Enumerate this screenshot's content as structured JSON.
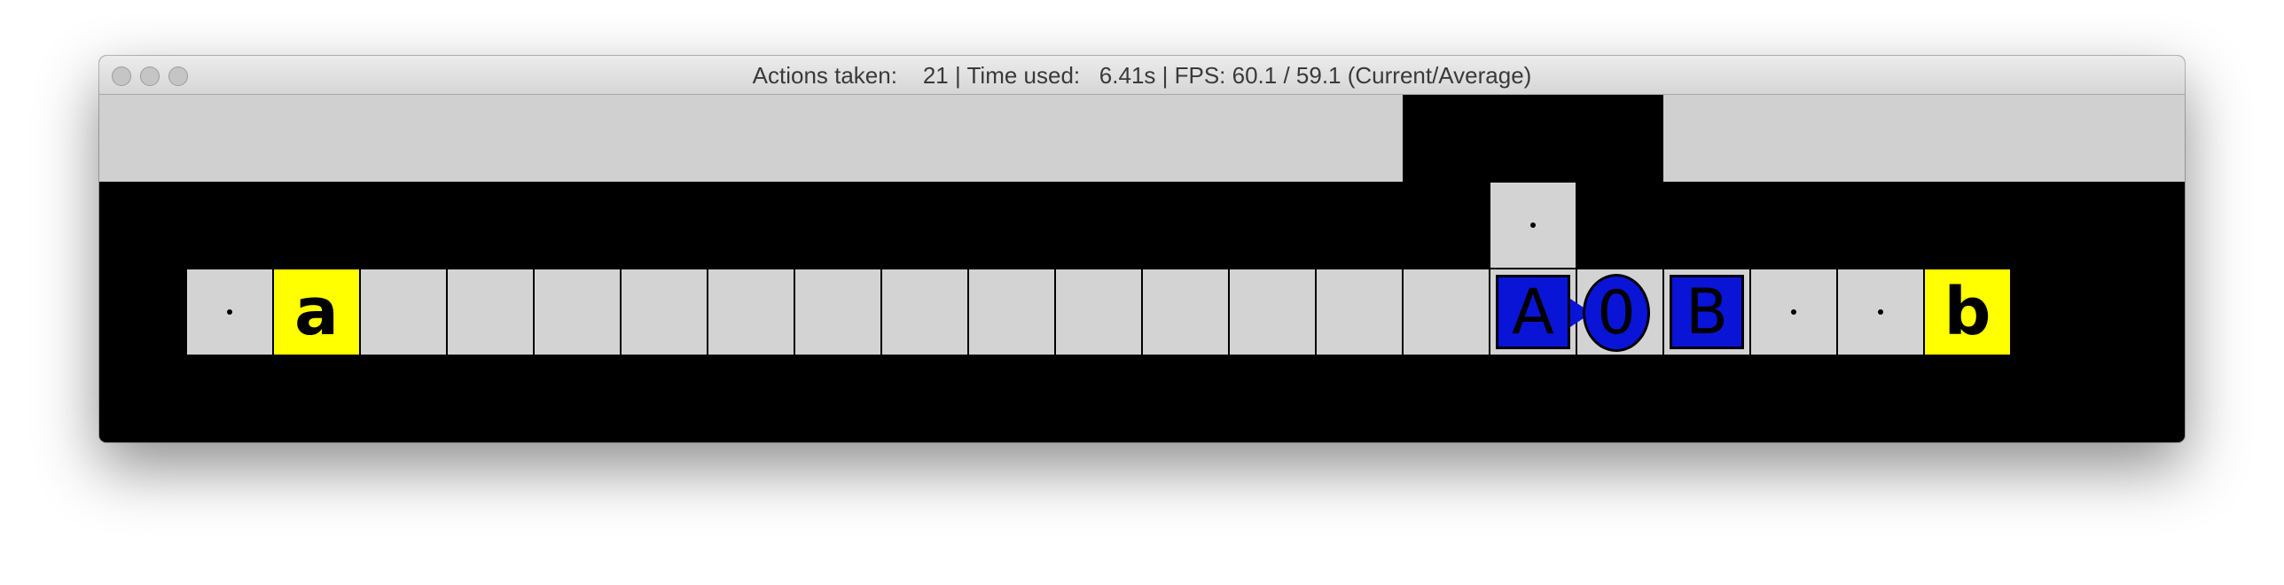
{
  "window": {
    "title": "Actions taken:    21 | Time used:   6.41s | FPS: 60.1 / 59.1 (Current/Average)"
  },
  "grid": {
    "row": [
      {
        "kind": "dot"
      },
      {
        "kind": "goal",
        "label": "a"
      },
      {
        "kind": "empty"
      },
      {
        "kind": "empty"
      },
      {
        "kind": "empty"
      },
      {
        "kind": "empty"
      },
      {
        "kind": "empty"
      },
      {
        "kind": "empty"
      },
      {
        "kind": "empty"
      },
      {
        "kind": "empty"
      },
      {
        "kind": "empty"
      },
      {
        "kind": "empty"
      },
      {
        "kind": "empty"
      },
      {
        "kind": "empty"
      },
      {
        "kind": "empty"
      },
      {
        "kind": "box",
        "label": "A"
      },
      {
        "kind": "agent",
        "label": "0",
        "facing": "left"
      },
      {
        "kind": "box",
        "label": "B"
      },
      {
        "kind": "dot"
      },
      {
        "kind": "dot"
      },
      {
        "kind": "goal",
        "label": "b"
      }
    ],
    "above_cell": {
      "kind": "dot"
    }
  },
  "colors": {
    "floor": "#d3d3d3",
    "wall": "#000000",
    "goal": "#ffff00",
    "box": "#0a14d6",
    "agent": "#0a14d6"
  }
}
